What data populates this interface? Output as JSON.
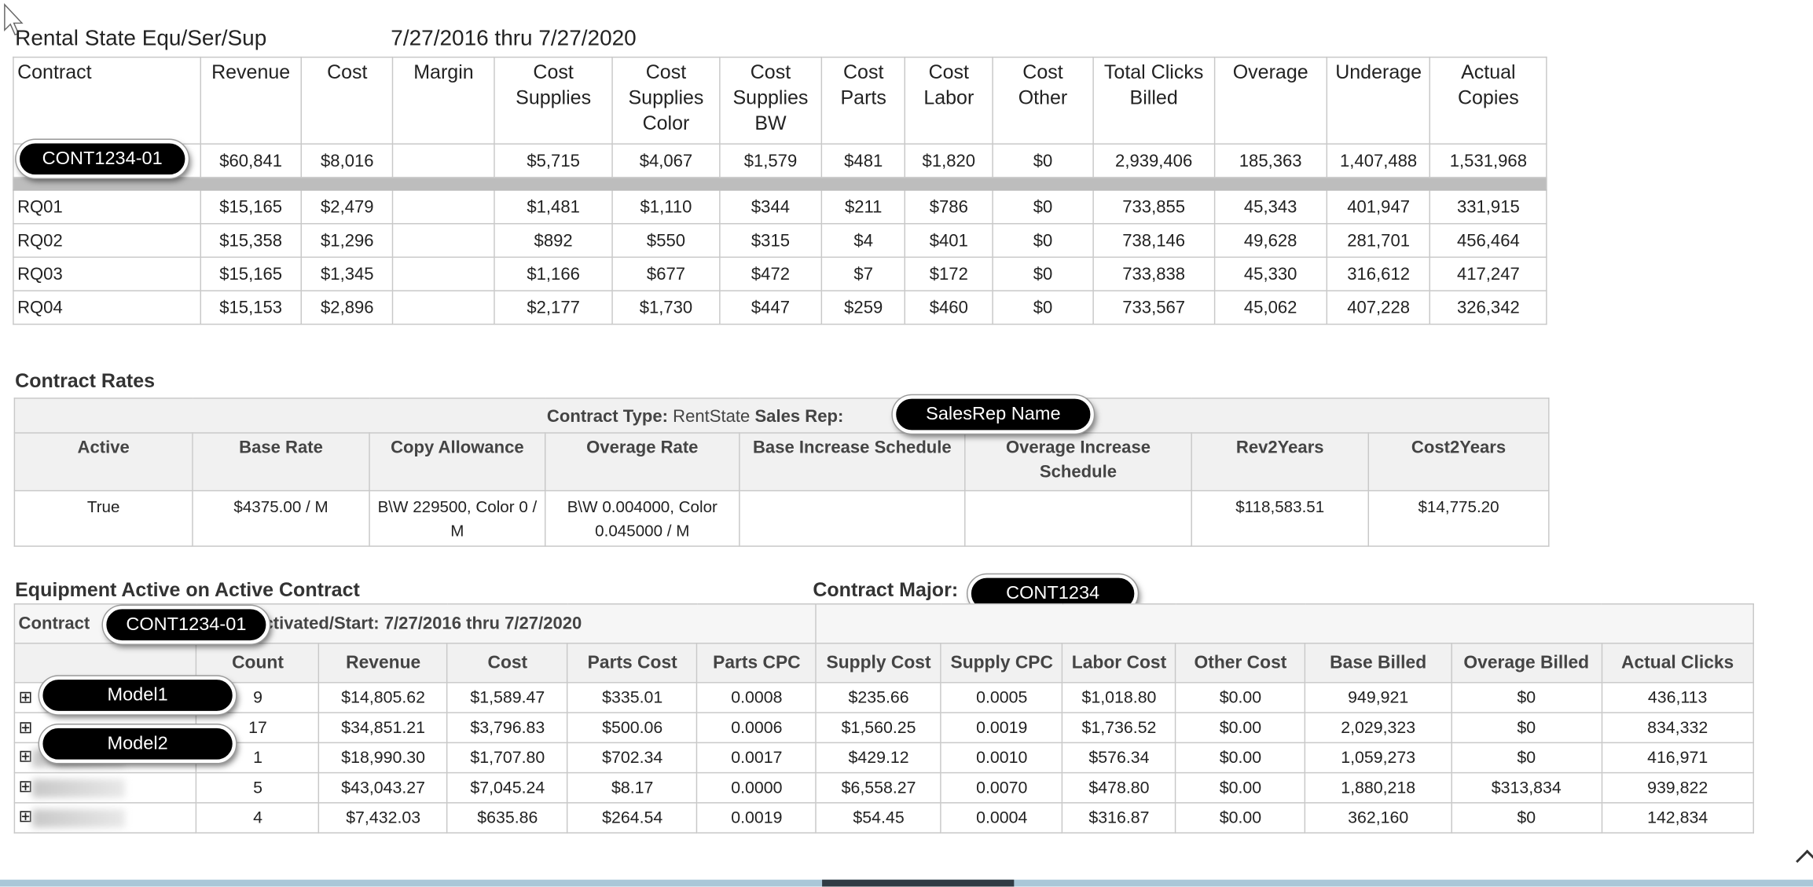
{
  "report": {
    "title": "Rental State Equ/Ser/Sup",
    "date_range": "7/27/2016 thru 7/27/2020"
  },
  "summary": {
    "headers": [
      "Contract",
      "Revenue",
      "Cost",
      "Margin",
      "Cost Supplies",
      "Cost Supplies Color",
      "Cost Supplies BW",
      "Cost Parts",
      "Cost Labor",
      "Cost Other",
      "Total Clicks Billed",
      "Overage",
      "Underage",
      "Actual Copies"
    ],
    "contract_row": [
      "CONT1234-01",
      "$60,841",
      "$8,016",
      "",
      "$5,715",
      "$4,067",
      "$1,579",
      "$481",
      "$1,820",
      "$0",
      "2,939,406",
      "185,363",
      "1,407,488",
      "1,531,968"
    ],
    "rows": [
      [
        "RQ01",
        "$15,165",
        "$2,479",
        "",
        "$1,481",
        "$1,110",
        "$344",
        "$211",
        "$786",
        "$0",
        "733,855",
        "45,343",
        "401,947",
        "331,915"
      ],
      [
        "RQ02",
        "$15,358",
        "$1,296",
        "",
        "$892",
        "$550",
        "$315",
        "$4",
        "$401",
        "$0",
        "738,146",
        "49,628",
        "281,701",
        "456,464"
      ],
      [
        "RQ03",
        "$15,165",
        "$1,345",
        "",
        "$1,166",
        "$677",
        "$472",
        "$7",
        "$172",
        "$0",
        "733,838",
        "45,330",
        "316,612",
        "417,247"
      ],
      [
        "RQ04",
        "$15,153",
        "$2,896",
        "",
        "$2,177",
        "$1,730",
        "$447",
        "$259",
        "$460",
        "$0",
        "733,567",
        "45,062",
        "407,228",
        "326,342"
      ]
    ]
  },
  "contract_rates": {
    "section_title": "Contract Rates",
    "type_label": "Contract Type:",
    "type_value": "RentState",
    "sales_rep_label": "Sales Rep:",
    "sales_rep_value": "SalesRep Name",
    "headers": [
      "Active",
      "Base Rate",
      "Copy Allowance",
      "Overage Rate",
      "Base Increase Schedule",
      "Overage Increase Schedule",
      "Rev2Years",
      "Cost2Years"
    ],
    "row": [
      "True",
      "$4375.00 / M",
      "B\\W 229500, Color 0 / M",
      "B\\W 0.004000, Color 0.045000 / M",
      "",
      "",
      "$118,583.51",
      "$14,775.20"
    ]
  },
  "equipment": {
    "section_title": "Equipment Active on Active Contract",
    "contract_major_label": "Contract Major:",
    "contract_major_value": "CONT1234",
    "sub_label_prefix": "Contract",
    "sub_contract_value": "CONT1234-01",
    "sub_label_suffix": "ctivated/Start: 7/27/2016 thru 7/27/2020",
    "headers": [
      "",
      "Count",
      "Revenue",
      "Cost",
      "Parts Cost",
      "Parts CPC",
      "Supply Cost",
      "Supply CPC",
      "Labor Cost",
      "Other Cost",
      "Base Billed",
      "Overage Billed",
      "Actual Clicks"
    ],
    "rows": [
      {
        "model": "Model1",
        "cells": [
          "9",
          "$14,805.62",
          "$1,589.47",
          "$335.01",
          "0.0008",
          "$235.66",
          "0.0005",
          "$1,018.80",
          "$0.00",
          "949,921",
          "$0",
          "436,113"
        ]
      },
      {
        "model": "Model2",
        "cells": [
          "17",
          "$34,851.21",
          "$3,796.83",
          "$500.06",
          "0.0006",
          "$1,560.25",
          "0.0019",
          "$1,736.52",
          "$0.00",
          "2,029,323",
          "$0",
          "834,332"
        ]
      },
      {
        "model": "",
        "cells": [
          "1",
          "$18,990.30",
          "$1,707.80",
          "$702.34",
          "0.0017",
          "$429.12",
          "0.0010",
          "$576.34",
          "$0.00",
          "1,059,273",
          "$0",
          "416,971"
        ]
      },
      {
        "model": "",
        "cells": [
          "5",
          "$43,043.27",
          "$7,045.24",
          "$8.17",
          "0.0000",
          "$6,558.27",
          "0.0070",
          "$478.80",
          "$0.00",
          "1,880,218",
          "$313,834",
          "939,822"
        ]
      },
      {
        "model": "",
        "cells": [
          "4",
          "$7,432.03",
          "$635.86",
          "$264.54",
          "0.0019",
          "$54.45",
          "0.0004",
          "$316.87",
          "$0.00",
          "362,160",
          "$0",
          "142,834"
        ]
      }
    ],
    "expand_glyph": "⊞"
  }
}
